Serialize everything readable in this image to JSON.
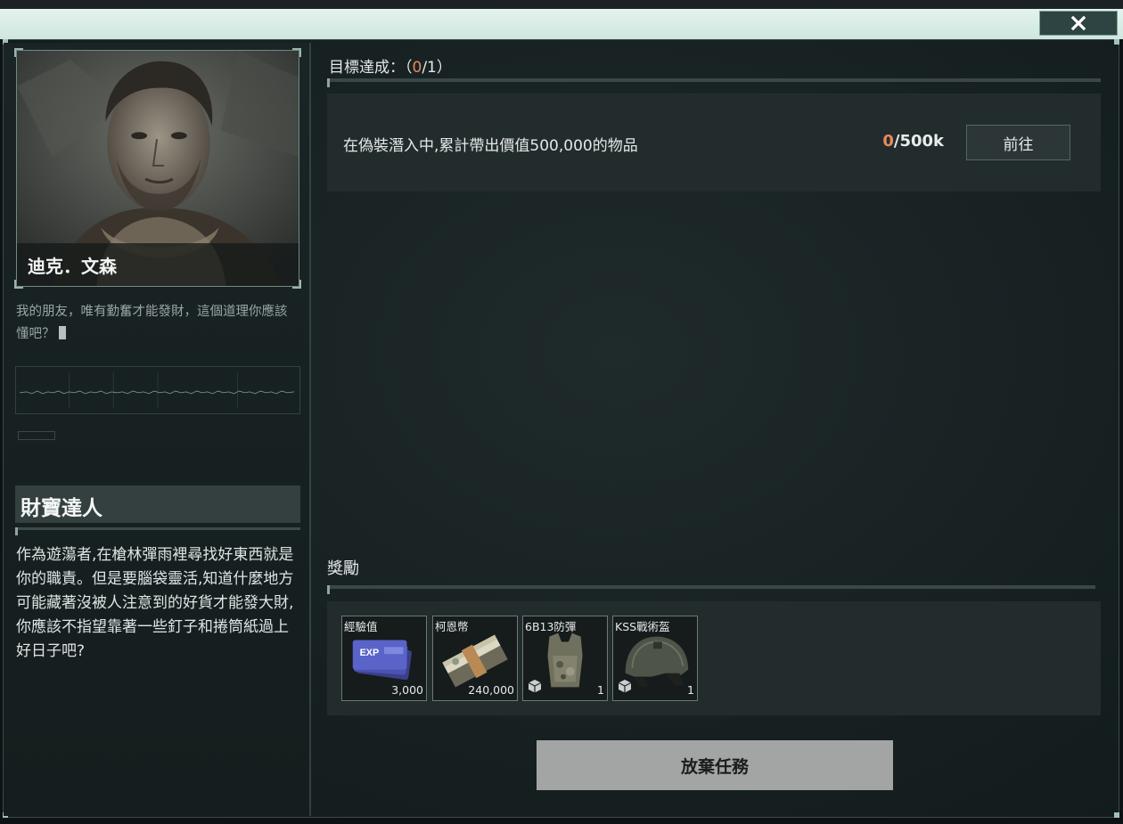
{
  "window": {
    "close_icon": "close-icon"
  },
  "npc": {
    "name": "迪克．文森",
    "quote": "我的朋友，唯有勤奮才能發財，這個道理你應該懂吧？"
  },
  "mission": {
    "title": "財寶達人",
    "description": "作為遊蕩者,在槍林彈雨裡尋找好東西就是你的職責。但是要腦袋靈活,知道什麼地方可能藏著沒被人注意到的好貨才能發大財,你應該不指望靠著一些釘子和捲筒紙過上好日子吧?"
  },
  "objectives": {
    "label": "目標達成：",
    "open_paren": "（",
    "done": "0",
    "total": "/1）",
    "items": [
      {
        "text": "在偽裝潛入中,累計帶出價值500,000的物品",
        "progress_done": "0",
        "progress_total": "/500k",
        "goto_label": "前往"
      }
    ]
  },
  "rewards": {
    "label": "獎勵",
    "items": [
      {
        "name": "經驗值",
        "qty": "3,000",
        "icon": "exp-ticket-icon"
      },
      {
        "name": "柯恩幣",
        "qty": "240,000",
        "icon": "cash-stack-icon"
      },
      {
        "name": "6B13防彈",
        "qty": "1",
        "icon": "body-armor-icon"
      },
      {
        "name": "KSS戰術盔",
        "qty": "1",
        "icon": "tactical-helmet-icon"
      }
    ]
  },
  "actions": {
    "abandon_label": "放棄任務"
  },
  "colors": {
    "accent_orange": "#e88a5c",
    "titlebar": "#d8ece6",
    "panel": "#232c2c"
  }
}
